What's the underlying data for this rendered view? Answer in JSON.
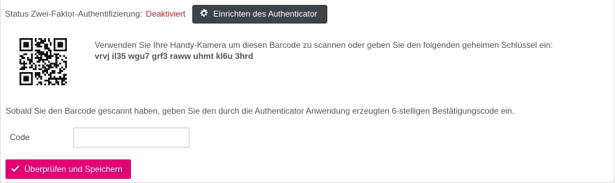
{
  "status": {
    "label": "Status Zwei-Faktor-Authentifizierung:",
    "value": "Deaktiviert",
    "value_color": "#c2262e"
  },
  "setup_button": {
    "label": "Einrichten des Authenticator",
    "icon": "gear-icon"
  },
  "qr": {
    "icon": "qr-code"
  },
  "instructions": {
    "scan_text": "Verwenden Sie Ihre Handy-Kamera um diesen Barcode zu scannen oder geben Sie den folgenden geheimen Schlüssel ein:",
    "secret_key": "vrvj il35 wgu7 grf3 raww uhmt kl6u 3hrd",
    "after_scan_text": "Sobald Sie den Barcode gescannt haben, geben Sie den durch die Authenticator Anwendung erzeugten 6-stelligen Bestätigungscode ein."
  },
  "code_field": {
    "label": "Code",
    "value": "",
    "placeholder": ""
  },
  "verify_button": {
    "label": "Überprüfen und Speichern",
    "icon": "check-icon",
    "color": "#e20074"
  }
}
